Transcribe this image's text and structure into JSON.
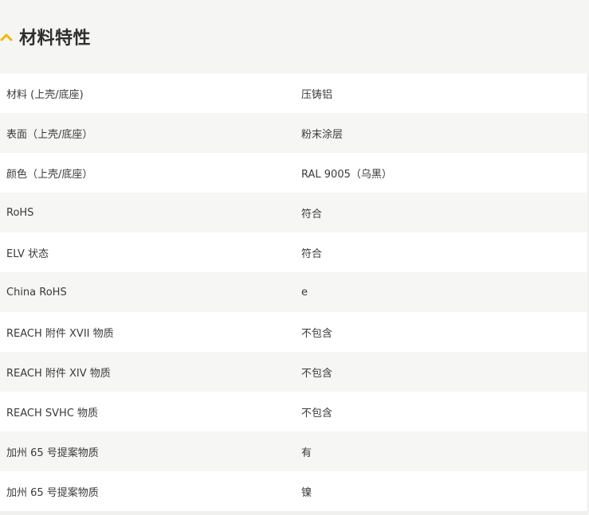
{
  "section": {
    "title": "材料特性",
    "accent_color": "#f2b705",
    "toggle_icon": "chevron-up-icon"
  },
  "rows": [
    {
      "label": "材料 (上壳/底座)",
      "value": "压铸铝"
    },
    {
      "label": "表面（上壳/底座）",
      "value": "粉末涂层"
    },
    {
      "label": "颜色（上壳/底座）",
      "value": "RAL 9005（乌黑）"
    },
    {
      "label": "RoHS",
      "value": "符合"
    },
    {
      "label": "ELV 状态",
      "value": "符合"
    },
    {
      "label": "China RoHS",
      "value": "e"
    },
    {
      "label": "REACH 附件 XVII 物质",
      "value": "不包含"
    },
    {
      "label": "REACH 附件 XIV 物质",
      "value": "不包含"
    },
    {
      "label": "REACH SVHC 物质",
      "value": "不包含"
    },
    {
      "label": "加州 65 号提案物质",
      "value": "有"
    },
    {
      "label": "加州 65 号提案物质",
      "value": "镍"
    }
  ]
}
